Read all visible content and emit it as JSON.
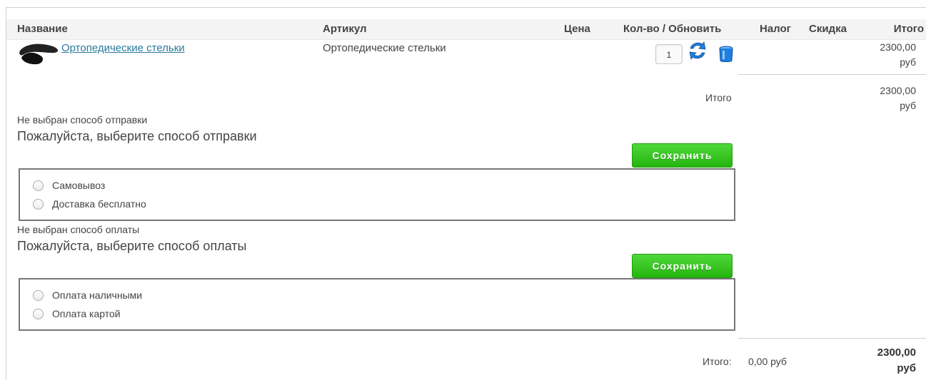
{
  "table": {
    "headers": {
      "name": "Название",
      "sku": "Артикул",
      "price": "Цена",
      "qty": "Кол-во / Обновить",
      "tax": "Налог",
      "discount": "Скидка",
      "total": "Итого"
    },
    "rows": [
      {
        "name": "Ортопедические стельки",
        "sku": "Ортопедические стельки",
        "quantity": "1",
        "total_line1": "2300,00",
        "total_line2": "руб"
      }
    ]
  },
  "subtotal": {
    "label": "Итого",
    "value_line1": "2300,00",
    "value_line2": "руб"
  },
  "shipping": {
    "status": "Не выбран способ отправки",
    "prompt": "Пожалуйста, выберите способ отправки",
    "save_label": "Сохранить",
    "options": [
      "Самовывоз",
      "Доставка бесплатно"
    ]
  },
  "payment": {
    "status": "Не выбран способ оплаты",
    "prompt": "Пожалуйста, выберите способ оплаты",
    "save_label": "Сохранить",
    "options": [
      "Оплата наличными",
      "Оплата картой"
    ]
  },
  "grand_total": {
    "label": "Итого:",
    "tax": "0,00 руб",
    "value_line1": "2300,00",
    "value_line2": "руб"
  },
  "icons": {
    "refresh": "refresh-icon",
    "delete": "trash-icon",
    "product": "insoles-thumbnail"
  },
  "colors": {
    "link": "#2a7a9b",
    "button_green": "#25b50f",
    "icon_blue": "#1e7fe0"
  }
}
